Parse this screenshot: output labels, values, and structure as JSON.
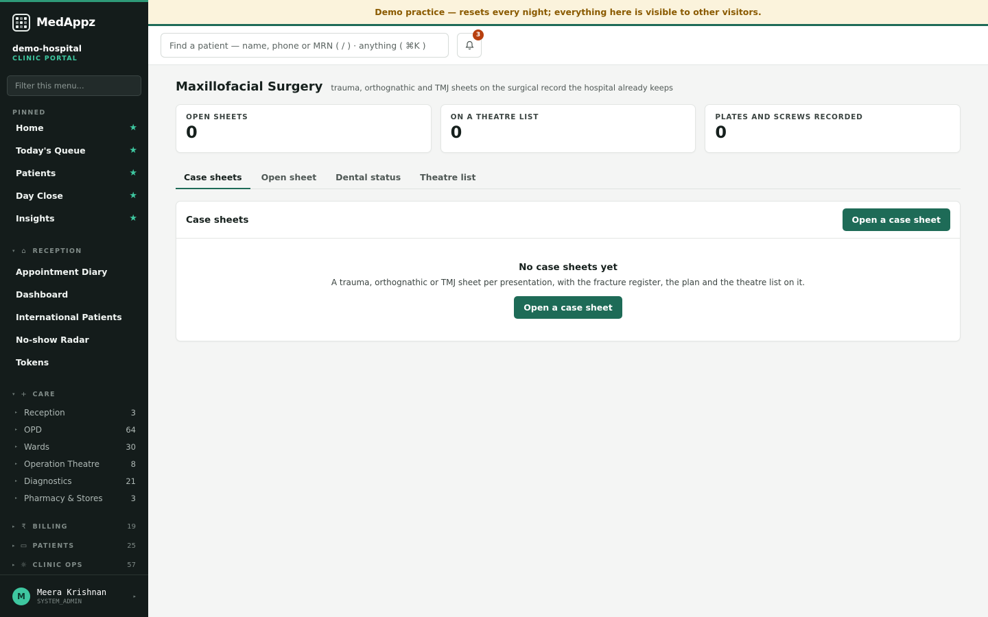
{
  "brand": {
    "name": "MedAppz"
  },
  "org": {
    "name": "demo-hospital",
    "portal": "CLINIC PORTAL"
  },
  "sidebar": {
    "filter_placeholder": "Filter this menu...",
    "pinned_label": "PINNED",
    "pinned": [
      {
        "label": "Home"
      },
      {
        "label": "Today's Queue"
      },
      {
        "label": "Patients"
      },
      {
        "label": "Day Close"
      },
      {
        "label": "Insights"
      }
    ],
    "reception": {
      "label": "RECEPTION",
      "icon": "home-icon",
      "items": [
        {
          "label": "Appointment Diary"
        },
        {
          "label": "Dashboard"
        },
        {
          "label": "International Patients"
        },
        {
          "label": "No-show Radar"
        },
        {
          "label": "Tokens"
        }
      ]
    },
    "care": {
      "label": "CARE",
      "icon": "plus-icon",
      "items": [
        {
          "label": "Reception",
          "count": "3"
        },
        {
          "label": "OPD",
          "count": "64"
        },
        {
          "label": "Wards",
          "count": "30"
        },
        {
          "label": "Operation Theatre",
          "count": "8"
        },
        {
          "label": "Diagnostics",
          "count": "21"
        },
        {
          "label": "Pharmacy & Stores",
          "count": "3"
        }
      ]
    },
    "billing": {
      "label": "BILLING",
      "count": "19",
      "icon": "rupee-icon"
    },
    "patients": {
      "label": "PATIENTS",
      "count": "25",
      "icon": "chat-icon"
    },
    "clinic_ops": {
      "label": "CLINIC OPS",
      "count": "57",
      "icon": "gear-icon"
    }
  },
  "user": {
    "initial": "M",
    "name": "Meera Krishnan",
    "role": "SYSTEM_ADMIN"
  },
  "banner": {
    "text": "Demo practice — resets every night; everything here is visible to other visitors."
  },
  "topbar": {
    "search_placeholder": "Find a patient — name, phone or MRN ( / ) · anything ( ⌘K )",
    "notifications": "3"
  },
  "page": {
    "title": "Maxillofacial Surgery",
    "subtitle": "trauma, orthognathic and TMJ sheets on the surgical record the hospital already keeps"
  },
  "stats": [
    {
      "label": "OPEN SHEETS",
      "value": "0"
    },
    {
      "label": "ON A THEATRE LIST",
      "value": "0"
    },
    {
      "label": "PLATES AND SCREWS RECORDED",
      "value": "0"
    }
  ],
  "tabs": [
    {
      "label": "Case sheets"
    },
    {
      "label": "Open sheet"
    },
    {
      "label": "Dental status"
    },
    {
      "label": "Theatre list"
    }
  ],
  "panel": {
    "title": "Case sheets",
    "action": "Open a case sheet",
    "empty_title": "No case sheets yet",
    "empty_text": "A trauma, orthognathic or TMJ sheet per presentation, with the fracture register, the plan and the theatre list on it.",
    "empty_action": "Open a case sheet"
  }
}
